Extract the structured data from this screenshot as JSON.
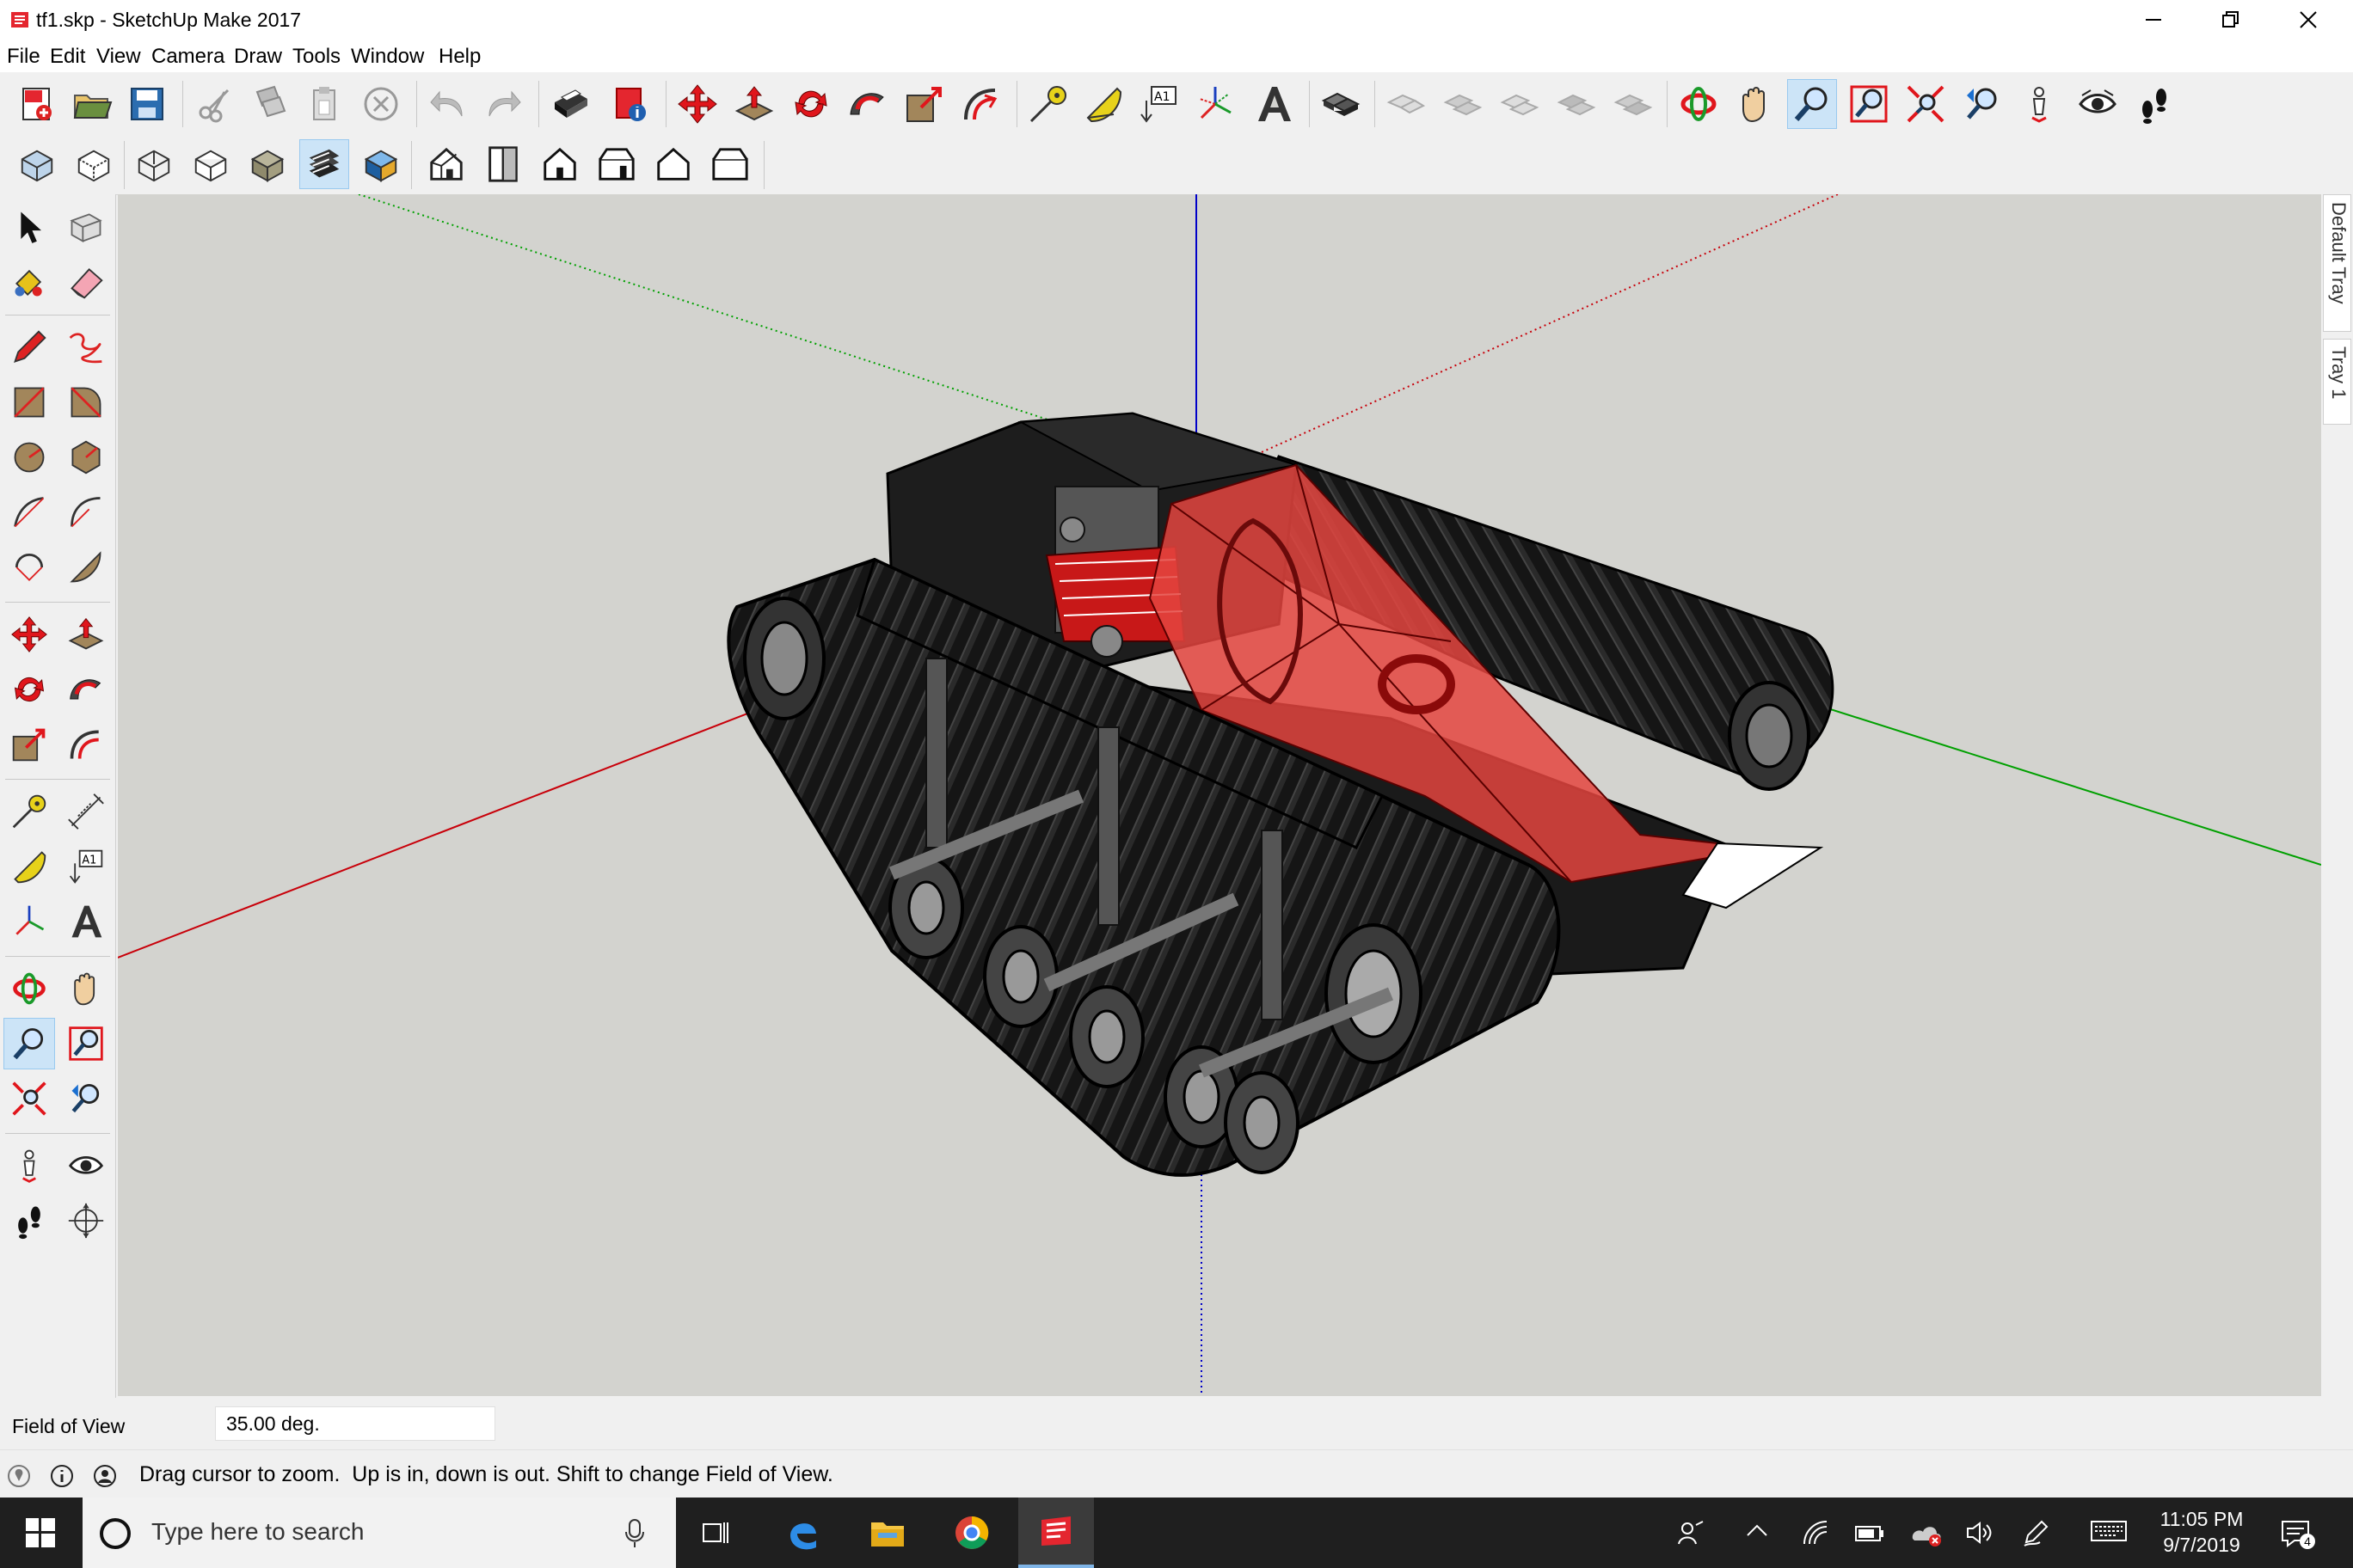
{
  "window": {
    "title": "tf1.skp - SketchUp Make 2017",
    "minimize_icon": "minimize-icon",
    "maximize_icon": "restore-icon",
    "close_icon": "close-icon"
  },
  "menu": [
    "File",
    "Edit",
    "View",
    "Camera",
    "Draw",
    "Tools",
    "Window",
    "Help"
  ],
  "toolbar_main": {
    "buttons": [
      "new-model",
      "open",
      "save",
      "cut",
      "copy",
      "paste",
      "erase",
      "undo",
      "redo",
      "print",
      "model-info",
      "move",
      "push-pull",
      "rotate",
      "follow-me",
      "scale",
      "offset",
      "tape-measure",
      "protractor",
      "text",
      "axes",
      "3d-text",
      "component",
      "outer-shell",
      "intersect",
      "union",
      "subtract",
      "trim",
      "split",
      "orbit",
      "pan",
      "zoom",
      "zoom-window",
      "zoom-extents",
      "previous-view",
      "position-camera",
      "look-around",
      "walk"
    ],
    "active": "zoom"
  },
  "toolbar_views": {
    "buttons": [
      "xray",
      "back-edges",
      "wireframe",
      "hidden-line",
      "shaded",
      "shaded-with-textures",
      "monochrome",
      "iso",
      "top",
      "front",
      "right",
      "back",
      "left"
    ],
    "active": "shaded-with-textures"
  },
  "left_tools": {
    "active": "zoom"
  },
  "viewport": {
    "background": "#d3d3cf",
    "axis_colors": {
      "red": "#c8000a",
      "green": "#00a000",
      "blue": "#0000c8"
    }
  },
  "tray": {
    "tabs": [
      "Default Tray",
      "Tray 1"
    ]
  },
  "measurements": {
    "label": "Field of View",
    "value": "35.00 deg."
  },
  "status": {
    "message": "Drag cursor to zoom.  Up is in, down is out. Shift to change Field of View.",
    "icons": [
      "geo-location-icon",
      "info-icon",
      "user-icon"
    ]
  },
  "taskbar": {
    "search_placeholder": "Type here to search",
    "apps": [
      "task-view",
      "edge",
      "file-explorer",
      "chrome",
      "sketchup"
    ],
    "active_app": "sketchup",
    "time": "11:05 PM",
    "date": "9/7/2019",
    "notifications": "4"
  }
}
